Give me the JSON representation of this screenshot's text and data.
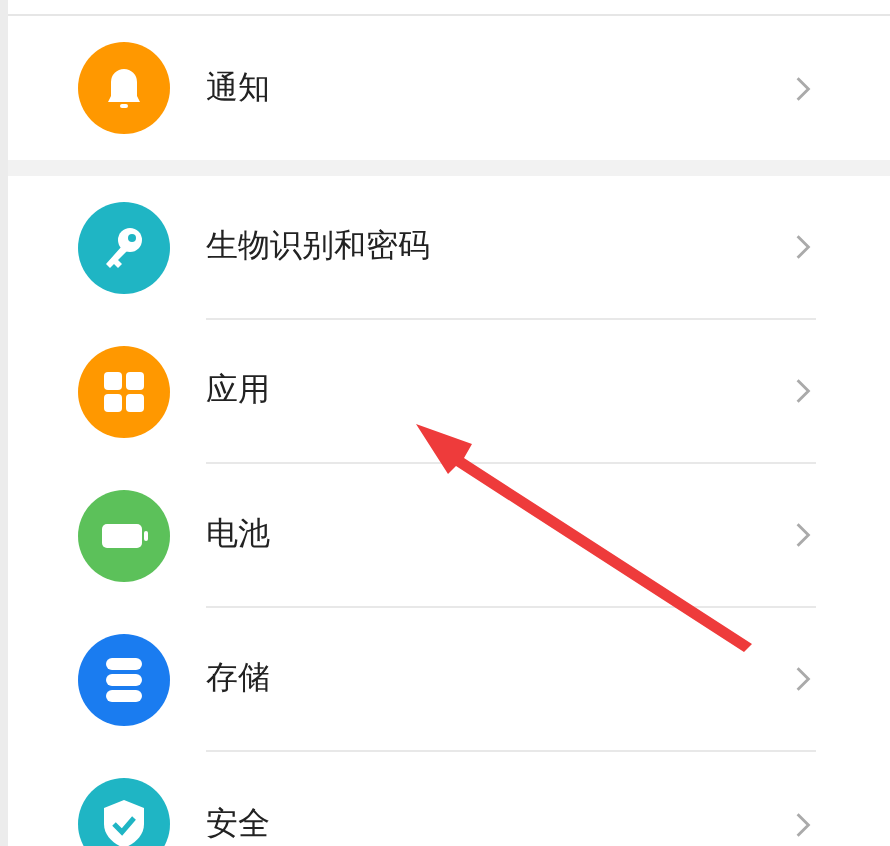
{
  "sections": [
    {
      "items": [
        {
          "kind": "bell",
          "label": "通知",
          "color": "#ff9800"
        }
      ]
    },
    {
      "items": [
        {
          "kind": "key",
          "label": "生物识别和密码",
          "color": "#1fb5c4"
        },
        {
          "kind": "grid",
          "label": "应用",
          "color": "#ff9800"
        },
        {
          "kind": "battery",
          "label": "电池",
          "color": "#5cc15a"
        },
        {
          "kind": "storage",
          "label": "存储",
          "color": "#1a7cf0"
        },
        {
          "kind": "shield",
          "label": "安全",
          "color": "#1fb5c4"
        }
      ]
    }
  ]
}
